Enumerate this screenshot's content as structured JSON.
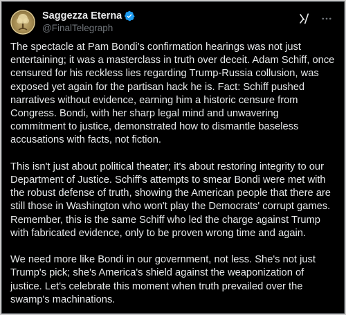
{
  "post": {
    "author": {
      "display_name": "Saggezza Eterna",
      "handle": "@FinalTelegraph",
      "verified": true
    },
    "paragraphs": [
      "The spectacle at Pam Bondi's confirmation hearings was not just entertaining; it was a masterclass in truth over deceit. Adam Schiff, once censured for his reckless lies regarding Trump-Russia collusion, was exposed yet again for the partisan hack he is. Fact: Schiff pushed narratives without evidence, earning him a historic censure from Congress. Bondi, with her sharp legal mind and unwavering commitment to justice, demonstrated how to dismantle baseless accusations with facts, not fiction.",
      "This isn't just about political theater; it's about restoring integrity to our Department of Justice. Schiff's attempts to smear Bondi were met with the robust defense of truth, showing the American people that there are still those in Washington who won't play the Democrats' corrupt games. Remember, this is the same Schiff who led the charge against Trump with fabricated evidence, only to be proven wrong time and again.",
      "We need more like Bondi in our government, not less. She's not just Trump's pick; she's America's shield against the weaponization of justice. Let's celebrate this moment when truth prevailed over the swamp's machinations."
    ]
  },
  "icons": {
    "verified": "verified-badge-icon",
    "grok": "grok-icon",
    "more": "more-options-icon"
  },
  "colors": {
    "background": "#000000",
    "text": "#e7e9ea",
    "secondary_text": "#71767b",
    "verified_blue": "#1d9bf0"
  }
}
